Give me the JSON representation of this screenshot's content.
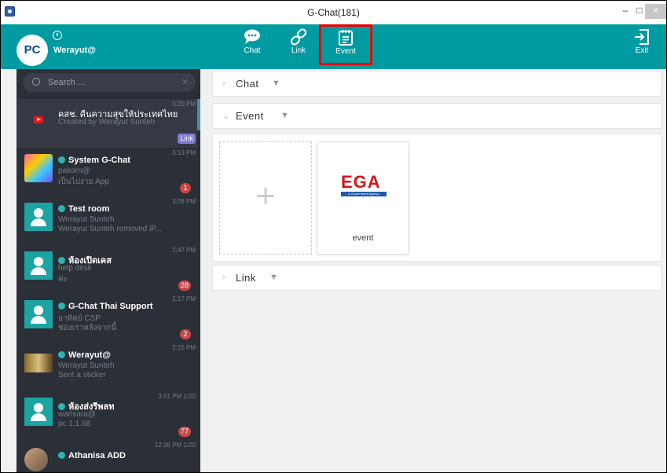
{
  "window": {
    "title": "G-Chat(181)",
    "min": "–",
    "max": "□",
    "close": "×"
  },
  "header": {
    "avatar_text": "PC",
    "user_name": "Werayut@",
    "nav": [
      {
        "label": "Chat",
        "icon": "chat-bubble-icon"
      },
      {
        "label": "Link",
        "icon": "link-icon"
      },
      {
        "label": "Event",
        "icon": "event-notes-icon"
      },
      {
        "label": "Exit",
        "icon": "exit-icon"
      }
    ]
  },
  "sidebar": {
    "search_placeholder": "Search ...",
    "search_clear": "×",
    "items": [
      {
        "name": "คสช. คืนความสุขให้ประเทศไทย",
        "line1": "Created by Werayut Sunteh",
        "line2": "",
        "time": "3:20 PM",
        "badge": "Link",
        "avatar": "youtube"
      },
      {
        "name": "System G-Chat",
        "line1": "pakorn@",
        "line2": "เป็นไปง่าย App",
        "time": "3:13 PM",
        "badge": "1",
        "avatar": "system"
      },
      {
        "name": "Test room",
        "line1": "Werayut Sunteh",
        "line2": "Werayut Sunteh removed iP...",
        "time": "3:08 PM",
        "badge": "",
        "avatar": "person"
      },
      {
        "name": "ห้องเปิดเคส",
        "line1": "help desk",
        "line2": "ค่ะ",
        "time": "2:47 PM",
        "badge": "28",
        "avatar": "person"
      },
      {
        "name": "G-Chat Thai Support",
        "line1": "อาทิตย์ CSP",
        "line2": "ช่องเราหลังจากนี้",
        "time": "2:17 PM",
        "badge": "2",
        "avatar": "person"
      },
      {
        "name": "Werayut@",
        "line1": "Werayut Sunteh",
        "line2": "Sent a sticker",
        "time": "2:15 PM",
        "badge": "",
        "avatar": "photo"
      },
      {
        "name": "ห้องส่งรีพลท",
        "line1": "warisara@",
        "line2": "pc 1.1.68",
        "time": "3:51 PM 1/20",
        "badge": "77",
        "avatar": "person"
      },
      {
        "name": "Athanisa ADD",
        "line1": "",
        "line2": "",
        "time": "12:26 PM 1/20",
        "badge": "",
        "avatar": "athanisa"
      }
    ]
  },
  "main": {
    "sections": [
      {
        "title": "Chat",
        "chevron": "›",
        "filter": "▼"
      },
      {
        "title": "Event",
        "chevron": "⌄",
        "filter": "▼"
      },
      {
        "title": "Link",
        "chevron": "›",
        "filter": "▼"
      }
    ],
    "add_symbol": "+",
    "event_card": {
      "logo_letters": "EGA",
      "logo_sub": "e-Government Agency",
      "caption": "event"
    }
  },
  "colors": {
    "header": "#009ba0",
    "sidebar": "#2b2f38",
    "highlight": "#ee0000",
    "badge": "#c94848"
  }
}
